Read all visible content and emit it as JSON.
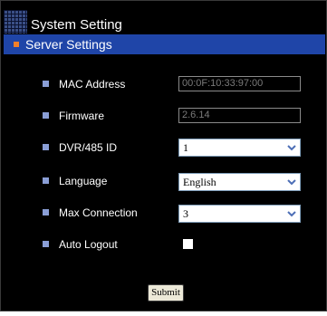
{
  "window": {
    "title": "System Setting",
    "title_icon": "grid-icon"
  },
  "section": {
    "title": "Server Settings"
  },
  "fields": {
    "mac_address": {
      "label": "MAC Address",
      "value": "00:0F:10:33:97:00"
    },
    "firmware": {
      "label": "Firmware",
      "value": "2.6.14"
    },
    "dvr_485_id": {
      "label": "DVR/485 ID",
      "value": "1"
    },
    "language": {
      "label": "Language",
      "value": "English"
    },
    "max_connection": {
      "label": "Max Connection",
      "value": "3"
    },
    "auto_logout": {
      "label": "Auto Logout",
      "checked": false
    }
  },
  "actions": {
    "submit_label": "Submit"
  },
  "colors": {
    "background": "#000000",
    "header_bar": "#1f45a8",
    "section_bullet": "#f07f2a",
    "row_bullet": "#8a9ed6",
    "text": "#ffffff",
    "disabled_text": "#7a7a7a"
  }
}
